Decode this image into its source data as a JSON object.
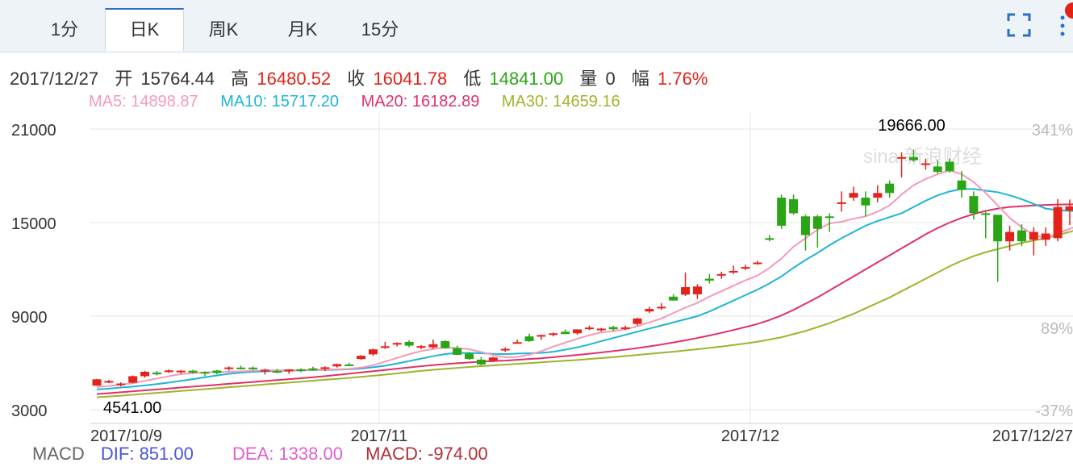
{
  "tabs": [
    {
      "label": "1分",
      "active": false
    },
    {
      "label": "日K",
      "active": true
    },
    {
      "label": "周K",
      "active": false
    },
    {
      "label": "月K",
      "active": false
    },
    {
      "label": "15分",
      "active": false
    }
  ],
  "icons": {
    "fullscreen": "fullscreen-icon",
    "more": "more-vertical-icon"
  },
  "info": {
    "date": "2017/12/27",
    "open_label": "开",
    "open": "15764.44",
    "high_label": "高",
    "high": "16480.52",
    "close_label": "收",
    "close": "16041.78",
    "low_label": "低",
    "low": "14841.00",
    "volume_label": "量",
    "volume": "0",
    "change_label": "幅",
    "change": "1.76%"
  },
  "ma": {
    "ma5": "MA5: 14898.87",
    "ma10": "MA10: 15717.20",
    "ma20": "MA20: 16182.89",
    "ma30": "MA30: 14659.16"
  },
  "macd": {
    "label": "MACD",
    "dif": "DIF: 851.00",
    "dea": "DEA: 1338.00",
    "macd": "MACD: -974.00"
  },
  "colors": {
    "up": "#e2231a",
    "down": "#2aa515",
    "ma5": "#f49ab8",
    "ma10": "#1eb4d8",
    "ma20": "#e0306a",
    "ma30": "#9cb52c",
    "grid": "#e6e6e6",
    "axis_text": "#333333",
    "pct_text": "#bbbbbb",
    "tab_active": "#2a6fc9"
  },
  "chart_data": {
    "type": "candlestick",
    "y_ticks": [
      21000,
      15000,
      9000,
      3000
    ],
    "ylim": [
      2900,
      21500
    ],
    "pct_labels": [
      "341%",
      "89%",
      "-37%"
    ],
    "x_labels": [
      "2017/10/9",
      "2017/11",
      "2017/12",
      "2017/12/27"
    ],
    "max_label": "19666.00",
    "min_label": "4541.00",
    "watermark": "sina 新浪财经",
    "candles": [
      [
        4541,
        4980,
        4541,
        4950
      ],
      [
        4760,
        4910,
        4700,
        4840
      ],
      [
        4630,
        4760,
        4500,
        4680
      ],
      [
        4730,
        5200,
        4700,
        5150
      ],
      [
        5150,
        5500,
        5050,
        5430
      ],
      [
        5380,
        5480,
        5200,
        5270
      ],
      [
        5420,
        5590,
        5350,
        5520
      ],
      [
        5430,
        5550,
        5300,
        5500
      ],
      [
        5500,
        5560,
        5300,
        5380
      ],
      [
        5420,
        5450,
        5150,
        5390
      ],
      [
        5510,
        5560,
        5280,
        5350
      ],
      [
        5620,
        5780,
        5500,
        5710
      ],
      [
        5700,
        5820,
        5580,
        5640
      ],
      [
        5700,
        5770,
        5550,
        5620
      ],
      [
        5460,
        5630,
        5250,
        5560
      ],
      [
        5480,
        5620,
        5350,
        5440
      ],
      [
        5460,
        5600,
        5300,
        5580
      ],
      [
        5590,
        5650,
        5400,
        5510
      ],
      [
        5650,
        5760,
        5500,
        5600
      ],
      [
        5650,
        5780,
        5480,
        5720
      ],
      [
        5780,
        5950,
        5700,
        5920
      ],
      [
        5900,
        6010,
        5800,
        5830
      ],
      [
        6250,
        6500,
        6200,
        6460
      ],
      [
        6550,
        6920,
        6450,
        6870
      ],
      [
        6980,
        7350,
        6900,
        7070
      ],
      [
        7180,
        7320,
        7050,
        7280
      ],
      [
        7350,
        7460,
        7000,
        7110
      ],
      [
        7000,
        7150,
        6880,
        7080
      ],
      [
        7000,
        7500,
        6900,
        7200
      ],
      [
        7400,
        7450,
        6900,
        6950
      ],
      [
        6950,
        7100,
        6500,
        6520
      ],
      [
        6600,
        6700,
        6200,
        6250
      ],
      [
        6210,
        6380,
        5850,
        5900
      ],
      [
        6150,
        6400,
        6050,
        6350
      ],
      [
        6800,
        7000,
        6700,
        6900
      ],
      [
        7330,
        7500,
        7300,
        7330
      ],
      [
        7700,
        7880,
        7350,
        7400
      ],
      [
        7700,
        7820,
        7480,
        7790
      ],
      [
        7800,
        7950,
        7700,
        7900
      ],
      [
        8000,
        8150,
        7850,
        7850
      ],
      [
        7900,
        8150,
        7800,
        8150
      ],
      [
        8200,
        8400,
        8100,
        8270
      ],
      [
        8150,
        8250,
        8000,
        8200
      ],
      [
        8300,
        8380,
        8050,
        8160
      ],
      [
        8250,
        8400,
        8100,
        8280
      ],
      [
        8500,
        8900,
        8400,
        8850
      ],
      [
        9300,
        9600,
        9200,
        9460
      ],
      [
        9500,
        9850,
        9400,
        9600
      ],
      [
        10250,
        10420,
        10000,
        10000
      ],
      [
        10380,
        11800,
        10300,
        10860
      ],
      [
        10400,
        11050,
        10100,
        10900
      ],
      [
        11400,
        11700,
        11100,
        11280
      ],
      [
        11600,
        11850,
        11400,
        11700
      ],
      [
        11900,
        12250,
        11700,
        11900
      ],
      [
        12150,
        12300,
        11950,
        12150
      ],
      [
        12400,
        12550,
        12300,
        12440
      ],
      [
        14000,
        14200,
        13800,
        13950
      ],
      [
        16600,
        16800,
        14600,
        14800
      ],
      [
        16500,
        16800,
        15500,
        15600
      ],
      [
        15400,
        15500,
        13200,
        14200
      ],
      [
        15400,
        15500,
        13400,
        14600
      ],
      [
        15400,
        15600,
        14400,
        15300
      ],
      [
        16300,
        17000,
        15700,
        16300
      ],
      [
        16600,
        17300,
        16400,
        16900
      ],
      [
        16600,
        17000,
        15400,
        16100
      ],
      [
        16600,
        17400,
        16300,
        16900
      ],
      [
        17500,
        17700,
        16600,
        16900
      ],
      [
        19100,
        19500,
        17900,
        19200
      ],
      [
        19200,
        19666,
        18900,
        19000
      ],
      [
        18700,
        19100,
        18400,
        18800
      ],
      [
        18600,
        19000,
        18150,
        18250
      ],
      [
        18900,
        19100,
        18200,
        18300
      ],
      [
        17700,
        18300,
        16600,
        17100
      ],
      [
        16700,
        17000,
        15200,
        15600
      ],
      [
        15600,
        15700,
        14000,
        15500
      ],
      [
        15500,
        15500,
        11200,
        13800
      ],
      [
        13800,
        14800,
        13200,
        14400
      ],
      [
        14500,
        14900,
        13500,
        13800
      ],
      [
        13900,
        14700,
        12900,
        14400
      ],
      [
        13900,
        14700,
        13500,
        14300
      ],
      [
        14000,
        16500,
        13800,
        16000
      ],
      [
        15764.44,
        16480.52,
        14841,
        16041.78
      ]
    ],
    "ma5": [
      4450,
      4520,
      4600,
      4700,
      4850,
      5000,
      5150,
      5280,
      5350,
      5390,
      5410,
      5430,
      5460,
      5500,
      5520,
      5530,
      5540,
      5550,
      5560,
      5570,
      5590,
      5620,
      5700,
      5850,
      6080,
      6320,
      6560,
      6760,
      6900,
      6990,
      6950,
      6880,
      6700,
      6500,
      6360,
      6380,
      6530,
      6750,
      7050,
      7300,
      7550,
      7780,
      7950,
      8050,
      8150,
      8350,
      8600,
      8850,
      9200,
      9550,
      9850,
      10250,
      10600,
      10950,
      11300,
      11600,
      12100,
      12700,
      13450,
      14000,
      14550,
      14950,
      15050,
      15250,
      15400,
      15700,
      16100,
      16800,
      17400,
      17800,
      18100,
      18350,
      18100,
      17600,
      16900,
      16100,
      15300,
      14700,
      14200,
      14000,
      14300,
      14600,
      14899
    ],
    "ma10": [
      4300,
      4350,
      4420,
      4480,
      4560,
      4640,
      4740,
      4850,
      4960,
      5080,
      5200,
      5300,
      5380,
      5430,
      5460,
      5480,
      5500,
      5520,
      5540,
      5550,
      5570,
      5590,
      5640,
      5720,
      5820,
      5960,
      6120,
      6280,
      6430,
      6570,
      6640,
      6640,
      6620,
      6580,
      6560,
      6600,
      6620,
      6640,
      6720,
      6850,
      7000,
      7180,
      7400,
      7600,
      7800,
      8000,
      8200,
      8400,
      8600,
      8800,
      9000,
      9300,
      9650,
      10000,
      10350,
      10700,
      11100,
      11550,
      12100,
      12600,
      13050,
      13550,
      14000,
      14400,
      14800,
      15100,
      15350,
      15600,
      16000,
      16400,
      16750,
      17000,
      17150,
      17150,
      17050,
      16950,
      16750,
      16500,
      16200,
      15900,
      15800,
      15750,
      15717
    ],
    "ma20": [
      4000,
      4060,
      4120,
      4180,
      4240,
      4300,
      4360,
      4420,
      4480,
      4540,
      4600,
      4660,
      4720,
      4780,
      4840,
      4900,
      4960,
      5020,
      5080,
      5150,
      5230,
      5310,
      5390,
      5470,
      5550,
      5630,
      5710,
      5790,
      5860,
      5920,
      5980,
      6030,
      6080,
      6120,
      6150,
      6200,
      6250,
      6300,
      6370,
      6440,
      6510,
      6590,
      6670,
      6760,
      6850,
      6950,
      7060,
      7180,
      7310,
      7450,
      7600,
      7760,
      7930,
      8110,
      8300,
      8500,
      8750,
      9050,
      9400,
      9800,
      10200,
      10650,
      11100,
      11550,
      12000,
      12450,
      12900,
      13350,
      13800,
      14250,
      14650,
      15000,
      15300,
      15550,
      15750,
      15900,
      16000,
      16050,
      16100,
      16130,
      16160,
      16170,
      16183
    ],
    "ma30": [
      3800,
      3850,
      3900,
      3960,
      4020,
      4080,
      4140,
      4200,
      4260,
      4320,
      4380,
      4440,
      4500,
      4560,
      4620,
      4680,
      4740,
      4800,
      4860,
      4920,
      4980,
      5040,
      5110,
      5180,
      5250,
      5330,
      5410,
      5490,
      5560,
      5620,
      5680,
      5740,
      5790,
      5840,
      5890,
      5940,
      5990,
      6040,
      6090,
      6140,
      6190,
      6250,
      6310,
      6370,
      6440,
      6510,
      6580,
      6650,
      6720,
      6800,
      6880,
      6960,
      7050,
      7150,
      7250,
      7360,
      7500,
      7650,
      7850,
      8050,
      8300,
      8550,
      8850,
      9150,
      9500,
      9850,
      10200,
      10600,
      11000,
      11400,
      11800,
      12200,
      12550,
      12850,
      13100,
      13300,
      13500,
      13700,
      13850,
      14000,
      14200,
      14400,
      14659
    ]
  }
}
